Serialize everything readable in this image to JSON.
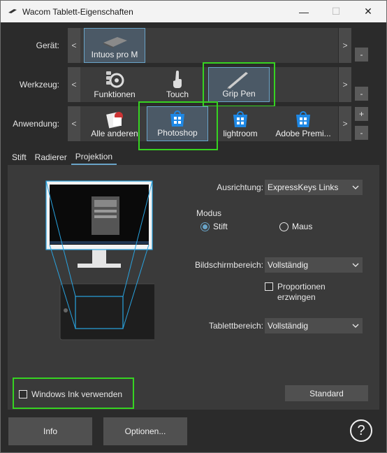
{
  "window": {
    "title": "Wacom Tablett-Eigenschaften"
  },
  "titlebar": {
    "minimize": "—",
    "maximize": "☐",
    "close": "✕"
  },
  "rows": {
    "device": {
      "label": "Gerät:",
      "prev": "<",
      "next": ">",
      "minus": "-",
      "tiles": [
        "Intuos pro M"
      ]
    },
    "tool": {
      "label": "Werkzeug:",
      "prev": "<",
      "next": ">",
      "minus": "-",
      "tiles": [
        "Funktionen",
        "Touch",
        "Grip Pen"
      ]
    },
    "app": {
      "label": "Anwendung:",
      "prev": "<",
      "next": ">",
      "plus": "+",
      "minus": "-",
      "tiles": [
        "Alle anderen",
        "Photoshop",
        "lightroom",
        "Adobe Premi..."
      ]
    }
  },
  "tabs": [
    "Stift",
    "Radierer",
    "Projektion"
  ],
  "active_tab": "Projektion",
  "mapping": {
    "orientation": {
      "label": "Ausrichtung:",
      "value": "ExpressKeys Links"
    },
    "mode": {
      "label": "Modus",
      "options": [
        "Stift",
        "Maus"
      ],
      "selected": "Stift"
    },
    "screen_area": {
      "label": "Bildschirmbereich:",
      "value": "Vollständig"
    },
    "force_proportions": {
      "label": "Proportionen erzwingen",
      "checked": false
    },
    "tablet_area": {
      "label": "Tablettbereich:",
      "value": "Vollständig"
    },
    "windows_ink": {
      "label": "Windows Ink verwenden",
      "checked": false
    },
    "default_button": "Standard"
  },
  "footer": {
    "info": "Info",
    "options": "Optionen...",
    "help": "?"
  },
  "colors": {
    "highlight_green": "#36d321",
    "accent_blue": "#69a4c8",
    "background": "#2b2b2b"
  },
  "icons": [
    "wacom-app-icon",
    "tablet-icon",
    "express-keys-icon",
    "touch-hand-icon",
    "pen-icon",
    "default-apps-icon",
    "windows-store-icon",
    "chevron-down-icon",
    "help-icon"
  ]
}
